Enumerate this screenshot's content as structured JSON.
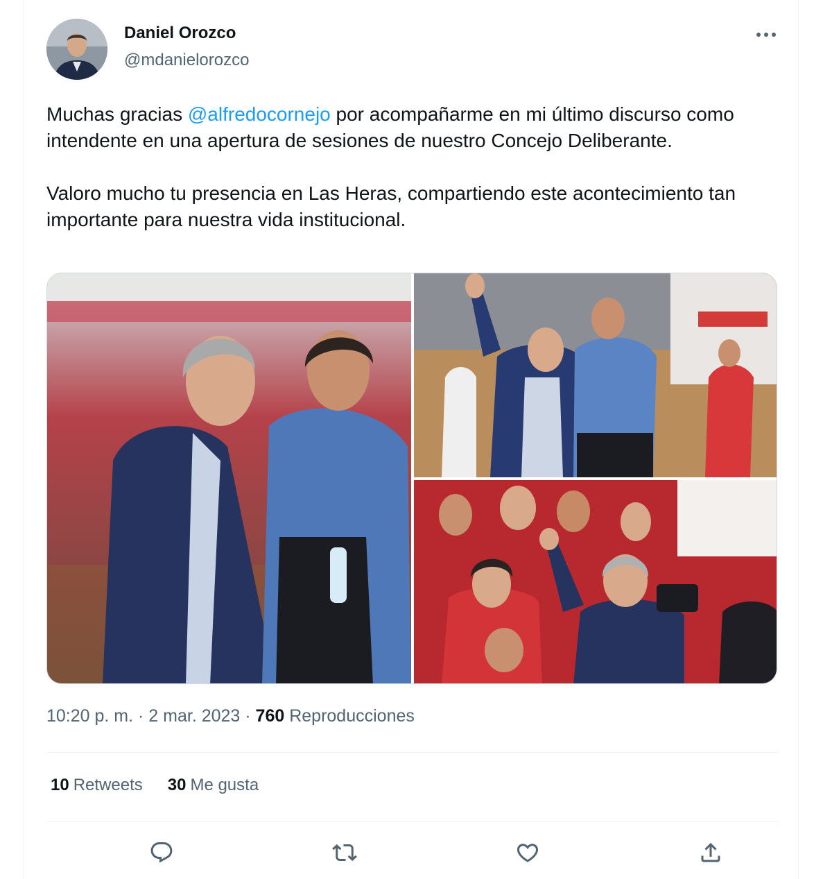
{
  "author": {
    "display_name": "Daniel Orozco",
    "handle": "@mdanielorozco",
    "avatar_icon": "profile-photo"
  },
  "tweet": {
    "text_part1_before": "Muchas gracias ",
    "mention": "@alfredocornejo",
    "text_part1_after": " por acompañarme en mi último discurso como intendente en una apertura de sesiones de nuestro Concejo Deliberante.",
    "text_part2": "Valoro mucho tu presencia en Las Heras, compartiendo este acontecimiento tan importante para nuestra vida institucional.",
    "media_count": 3
  },
  "meta": {
    "time": "10:20 p. m.",
    "separator": " · ",
    "date": "2 mar. 2023",
    "views_count": "760",
    "views_label": " Reproducciones"
  },
  "stats": {
    "retweets_count": "10",
    "retweets_label": "Retweets",
    "likes_count": "30",
    "likes_label": "Me gusta"
  },
  "actions": [
    "reply-icon",
    "retweet-icon",
    "like-icon",
    "share-icon"
  ],
  "colors": {
    "link": "#1d9bf0",
    "secondary_text": "#536471",
    "primary_text": "#0f1419",
    "divider": "#eff3f4"
  }
}
